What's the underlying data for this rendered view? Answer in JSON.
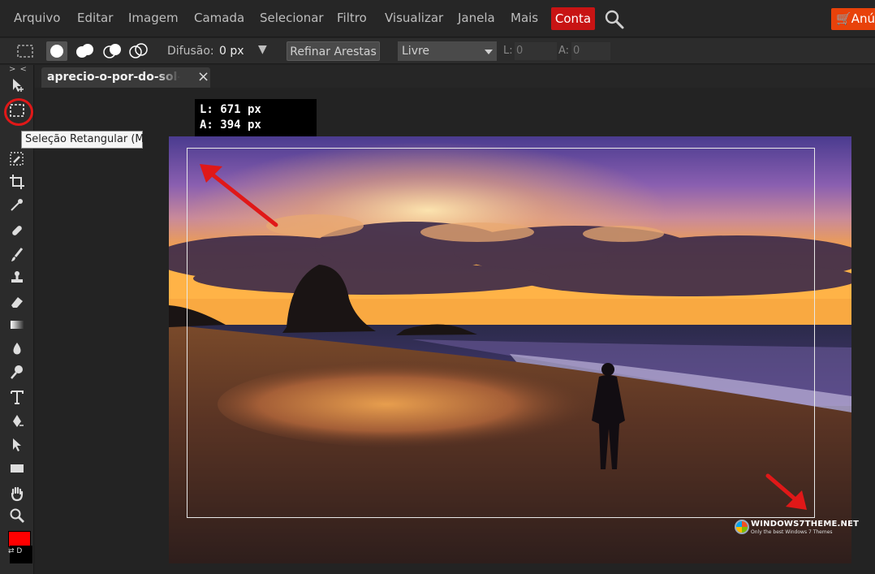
{
  "menubar": {
    "items": [
      "Arquivo",
      "Editar",
      "Imagem",
      "Camada",
      "Selecionar",
      "Filtro",
      "Visualizar",
      "Janela",
      "Mais"
    ],
    "account": "Conta",
    "ad_label": "Anúncio",
    "colors": {
      "account_bg": "#c81414",
      "ad_bg": "#e8420a"
    }
  },
  "options": {
    "feather_label": "Difusão:",
    "feather_value": "0 px",
    "refine_label": "Refinar Arestas",
    "style_value": "Livre",
    "width_label": "L:",
    "width_value": "0",
    "height_label": "A:",
    "height_value": "0"
  },
  "toolbox": {
    "collapse": "> <",
    "tooltip": "Seleção Retangular (M)",
    "swap_label": "⇄ D",
    "colors": {
      "foreground": "#ff0000",
      "background": "#000000"
    }
  },
  "document": {
    "tab_title": "aprecio-o-por-do-sol-w",
    "close": "×"
  },
  "readout": {
    "width": "L: 671 px",
    "height": "A: 394 px"
  },
  "watermark": {
    "title": "WINDOWS7THEME.NET",
    "subtitle": "Only the best Windows 7 Themes"
  },
  "annotation_color": "#e01818"
}
